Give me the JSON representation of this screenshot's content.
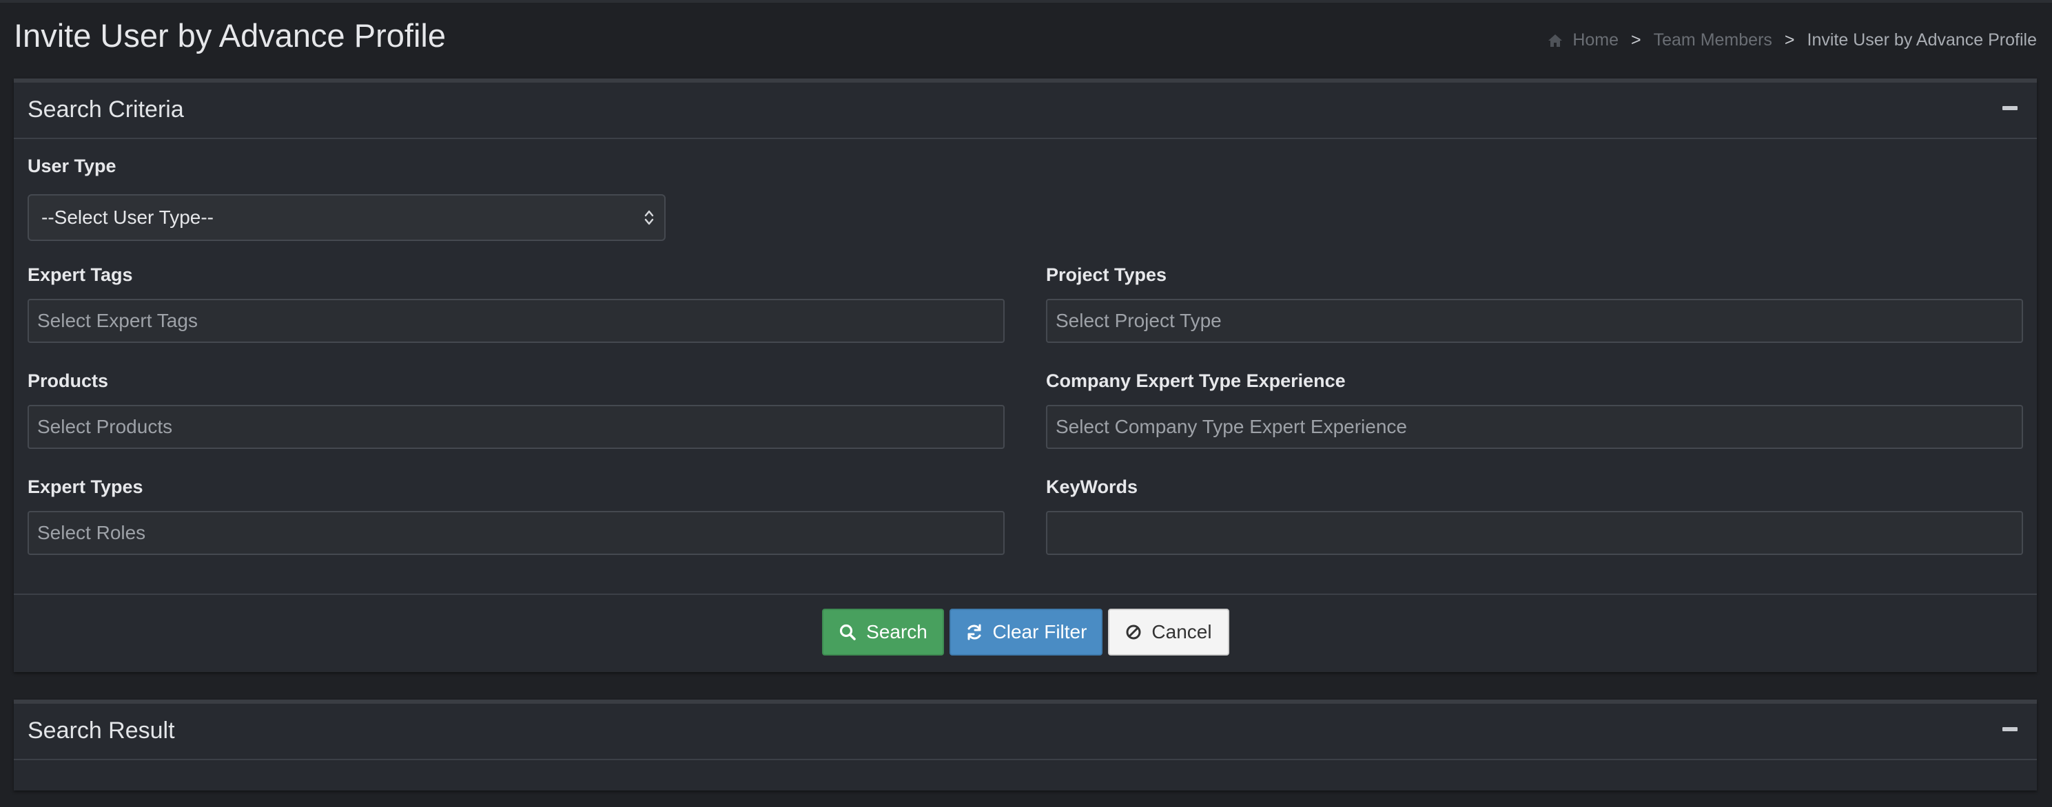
{
  "header": {
    "title": "Invite User by Advance Profile",
    "breadcrumb": {
      "home": "Home",
      "separator": ">",
      "team_members": "Team Members",
      "current": "Invite User by Advance Profile"
    }
  },
  "search_criteria": {
    "title": "Search Criteria",
    "user_type": {
      "label": "User Type",
      "selected": "--Select User Type--"
    },
    "expert_tags": {
      "label": "Expert Tags",
      "placeholder": "Select Expert Tags"
    },
    "project_types": {
      "label": "Project Types",
      "placeholder": "Select Project Type"
    },
    "products": {
      "label": "Products",
      "placeholder": "Select Products"
    },
    "company_expert_type_experience": {
      "label": "Company Expert Type Experience",
      "placeholder": "Select Company Type Expert Experience"
    },
    "expert_types": {
      "label": "Expert Types",
      "placeholder": "Select Roles"
    },
    "keywords": {
      "label": "KeyWords",
      "value": ""
    },
    "buttons": {
      "search": "Search",
      "clear_filter": "Clear Filter",
      "cancel": "Cancel"
    }
  },
  "search_result": {
    "title": "Search Result"
  },
  "icons": {
    "home": "home-icon",
    "collapse": "minus-icon",
    "search": "search-icon",
    "refresh": "refresh-icon",
    "cancel": "ban-icon",
    "select_arrows": "chevron-updown-icon"
  },
  "colors": {
    "background": "#1f2125",
    "panel": "#272a30",
    "search_button": "#48a05e",
    "clear_button": "#4a8cc4",
    "cancel_button": "#f4f4f4"
  }
}
